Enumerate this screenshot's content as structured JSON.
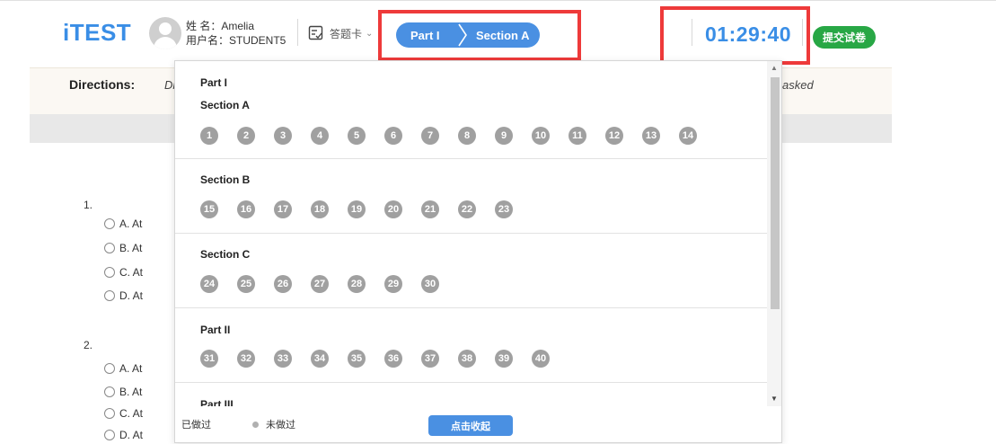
{
  "header": {
    "logo": "iTEST",
    "name_label": "姓 名：",
    "name_value": "Amelia",
    "username_label": "用户名：",
    "username_value": "STUDENT5",
    "answer_card_label": "答题卡",
    "breadcrumb": {
      "part": "Part I",
      "section": "Section A"
    },
    "timer": "01:29:40",
    "submit_label": "提交试卷"
  },
  "directions": {
    "label": "Directions:",
    "text_left": "Di ab",
    "text_right": "asked"
  },
  "questions": [
    {
      "number": "1.",
      "options": [
        "A. At",
        "B. At",
        "C. At",
        "D. At"
      ]
    },
    {
      "number": "2.",
      "options": [
        "A. At",
        "B. At",
        "C. At",
        "D. At"
      ]
    }
  ],
  "answer_panel": {
    "groups": [
      {
        "part": "Part I",
        "section": "Section A",
        "numbers": [
          "1",
          "2",
          "3",
          "4",
          "5",
          "6",
          "7",
          "8",
          "9",
          "10",
          "11",
          "12",
          "13",
          "14"
        ]
      },
      {
        "part": "",
        "section": "Section B",
        "numbers": [
          "15",
          "16",
          "17",
          "18",
          "19",
          "20",
          "21",
          "22",
          "23"
        ]
      },
      {
        "part": "",
        "section": "Section C",
        "numbers": [
          "24",
          "25",
          "26",
          "27",
          "28",
          "29",
          "30"
        ]
      },
      {
        "part": "Part II",
        "section": "",
        "numbers": [
          "31",
          "32",
          "33",
          "34",
          "35",
          "36",
          "37",
          "38",
          "39",
          "40"
        ]
      },
      {
        "part": "Part III",
        "section": "",
        "numbers": []
      }
    ],
    "legend_done": "已做过",
    "legend_undone": "未做过",
    "collapse_label": "点击收起"
  },
  "colors": {
    "accent": "#3a8ee6",
    "highlight": "#ee3a3a",
    "submit": "#28a745",
    "unanswered": "#a0a0a0",
    "done_dot": "#28a745",
    "undone_dot": "#b0b0b0"
  }
}
